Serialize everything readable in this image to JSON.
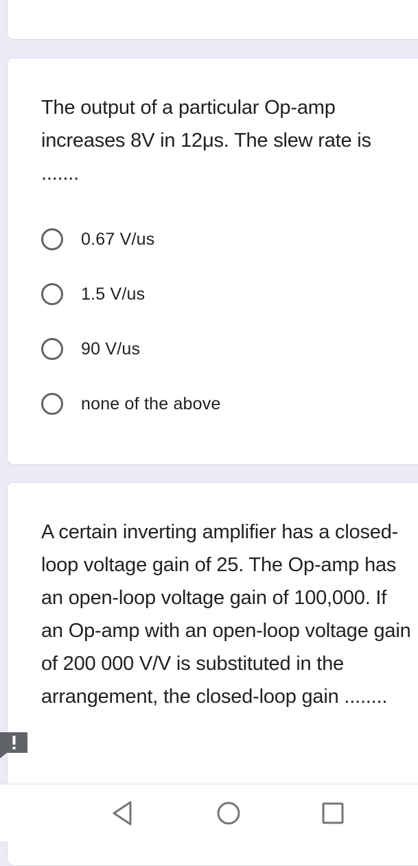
{
  "questions": [
    {
      "text": "The output of a particular Op-amp increases 8V in 12μs. The slew rate is .......",
      "options": [
        "0.67 V/us",
        "1.5 V/us",
        "90 V/us",
        "none of the above"
      ]
    },
    {
      "text": "A certain inverting amplifier has a closed-loop voltage gain of 25. The Op-amp has an open-loop voltage gain of 100,000. If an Op-amp with an open-loop voltage gain of 200 000 V/V is substituted in the arrangement, the closed-loop gain ........"
    }
  ],
  "icons": {
    "feedback": "report-feedback-icon",
    "back": "back-triangle-icon",
    "home": "home-circle-icon",
    "recents": "recents-square-icon"
  },
  "colors": {
    "page_background": "#ede9f6",
    "card_background": "#ffffff",
    "radio_border": "#5f6368",
    "feedback_icon": "#5f6368"
  }
}
